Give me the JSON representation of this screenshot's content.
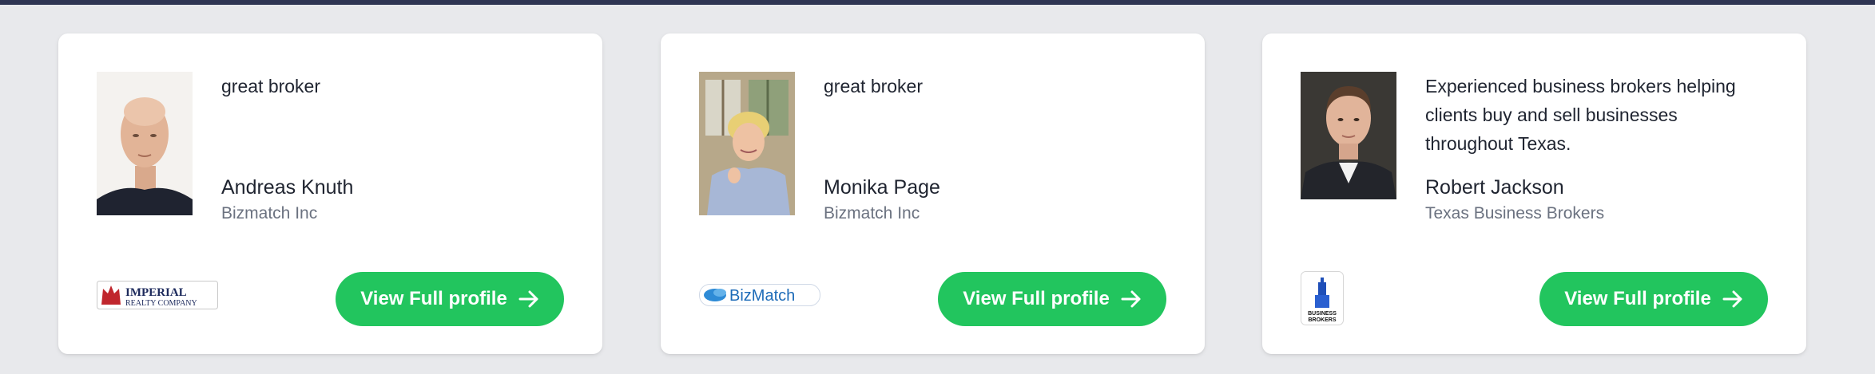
{
  "brokers": [
    {
      "quote": "great broker",
      "name": "Andreas Knuth",
      "company": "Bizmatch Inc",
      "logo_text": "IMPERIAL REALTY COMPANY",
      "button_label": "View Full profile"
    },
    {
      "quote": "great broker",
      "name": "Monika Page",
      "company": "Bizmatch Inc",
      "logo_text": "BizMatch",
      "button_label": "View Full profile"
    },
    {
      "quote": "Experienced business brokers helping clients buy and sell businesses throughout Texas.",
      "name": "Robert Jackson",
      "company": "Texas Business Brokers",
      "logo_text": "BUSINESS BROKERS",
      "button_label": "View Full profile"
    }
  ],
  "colors": {
    "accent": "#22c55e",
    "topbar": "#2f3553",
    "background": "#e8e9ec"
  },
  "icons": {
    "button": "arrow-right-icon"
  }
}
